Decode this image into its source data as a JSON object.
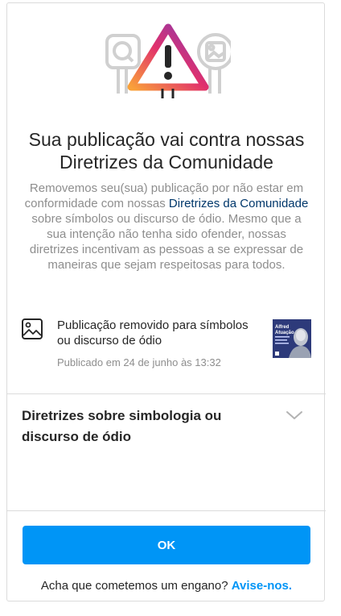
{
  "dialog": {
    "title_line1": "Sua publicação vai contra nossas",
    "title_line2": "Diretrizes da Comunidade",
    "description_before": "Removemos seu(sua) publicação por não estar em conformidade com nossas ",
    "guidelines_link": "Diretrizes da Comunidade",
    "description_after": " sobre símbolos ou discurso de ódio. Mesmo que a sua intenção não tenha sido ofender, nossas diretrizes incentivam as pessoas a se expressar de maneiras que sejam respeitosas para todos."
  },
  "post": {
    "icon": "image-icon",
    "title": "Publicação removido para símbolos ou discurso de ódio",
    "date": "Publicado em 24 de junho às 13:32",
    "thumbnail_text_1": "Alfred",
    "thumbnail_text_2": "Atuação",
    "thumbnail_bg": "#2d3a7a"
  },
  "guidelines_section": {
    "title": "Diretrizes sobre simbologia ou discurso de ódio",
    "chevron_icon": "chevron-down-icon"
  },
  "footer": {
    "ok_label": "OK",
    "feedback_question": "Acha que cometemos um engano?",
    "feedback_link": "Avise-nos."
  },
  "colors": {
    "primary": "#0095f6",
    "link_dark": "#00376b",
    "muted_text": "#8e8e8e",
    "border": "#dbdbdb"
  }
}
